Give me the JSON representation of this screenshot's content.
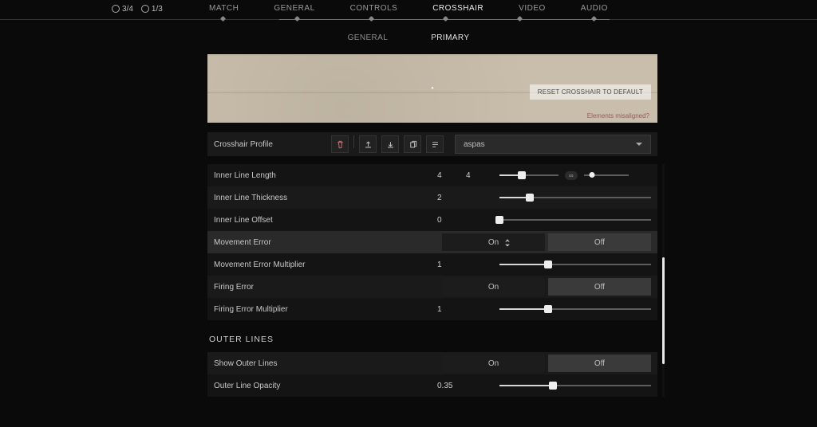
{
  "hud": {
    "players": "3/4",
    "round": "1/3"
  },
  "nav": {
    "items": [
      "MATCH",
      "GENERAL",
      "CONTROLS",
      "CROSSHAIR",
      "VIDEO",
      "AUDIO"
    ],
    "active": "CROSSHAIR"
  },
  "subnav": {
    "items": [
      "GENERAL",
      "PRIMARY"
    ],
    "active": "PRIMARY"
  },
  "preview": {
    "reset": "RESET CROSSHAIR TO DEFAULT",
    "misaligned": "Elements misaligned?"
  },
  "profile": {
    "label": "Crosshair Profile",
    "selected": "aspas"
  },
  "settings": {
    "innerLineLength": {
      "label": "Inner Line Length",
      "valA": "4",
      "valB": "4",
      "pctA": 38,
      "link": "∞",
      "pctB": 18
    },
    "innerLineThickness": {
      "label": "Inner Line Thickness",
      "val": "2",
      "pct": 20
    },
    "innerLineOffset": {
      "label": "Inner Line Offset",
      "val": "0",
      "pct": 0
    },
    "movementError": {
      "label": "Movement Error",
      "on": "On",
      "off": "Off"
    },
    "movementErrorMult": {
      "label": "Movement Error Multiplier",
      "val": "1",
      "pct": 32
    },
    "firingError": {
      "label": "Firing Error",
      "on": "On",
      "off": "Off"
    },
    "firingErrorMult": {
      "label": "Firing Error Multiplier",
      "val": "1",
      "pct": 32
    }
  },
  "sections": {
    "outer": "OUTER LINES"
  },
  "outer": {
    "show": {
      "label": "Show Outer Lines",
      "on": "On",
      "off": "Off"
    },
    "opacity": {
      "label": "Outer Line Opacity",
      "val": "0.35",
      "pct": 35
    }
  }
}
